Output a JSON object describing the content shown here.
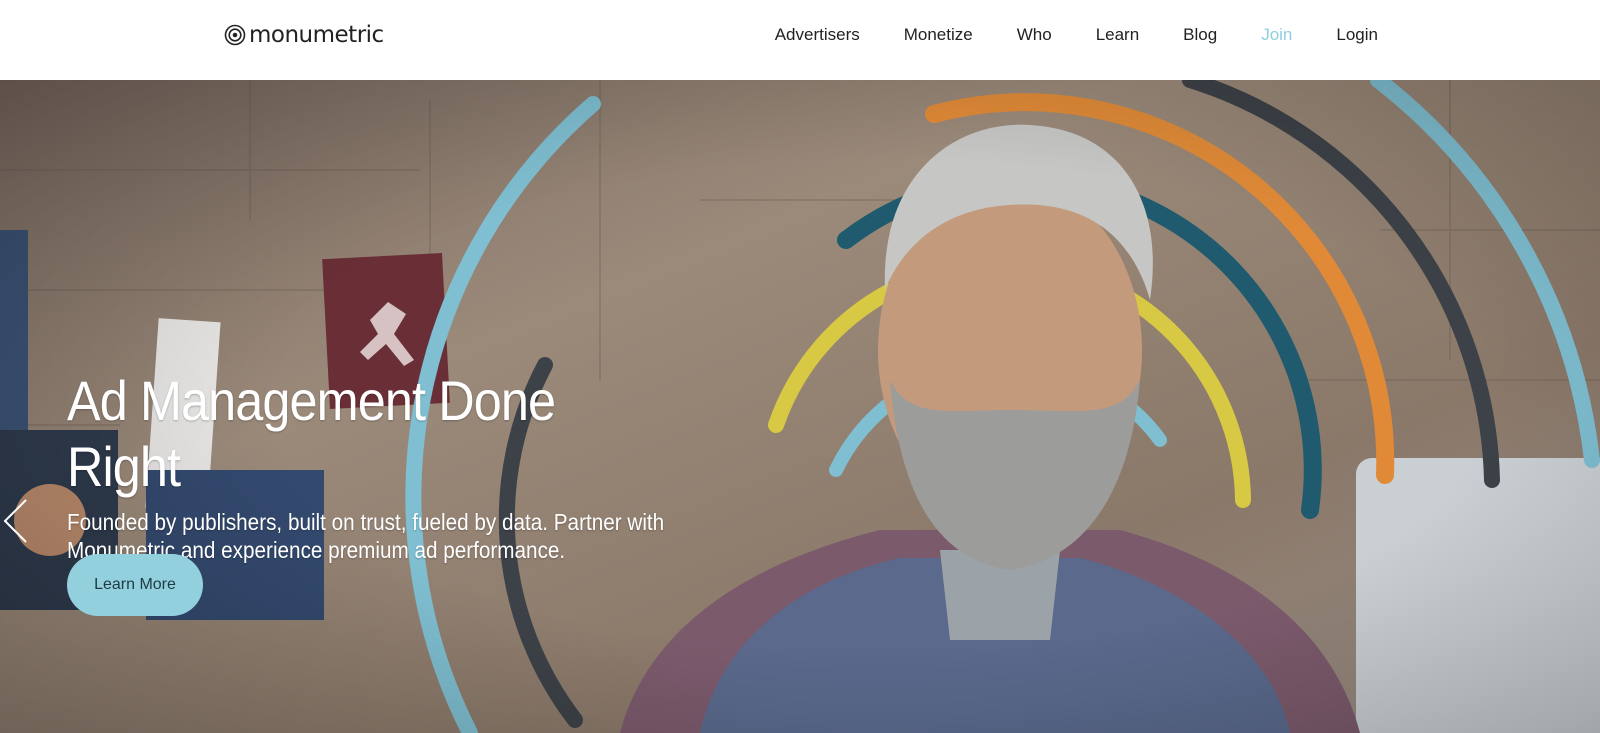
{
  "brand": {
    "name": "monumetric"
  },
  "nav": {
    "items": [
      {
        "label": "Advertisers"
      },
      {
        "label": "Monetize"
      },
      {
        "label": "Who"
      },
      {
        "label": "Learn"
      },
      {
        "label": "Blog"
      },
      {
        "label": "Join",
        "active": true
      },
      {
        "label": "Login"
      }
    ]
  },
  "hero": {
    "title": "Ad Management Done Right",
    "subtitle": "Founded by publishers, built on trust, fueled by data. Partner with Monumetric and experience premium ad performance.",
    "cta_label": "Learn More",
    "prev_icon": "chevron-left-icon"
  },
  "colors": {
    "accent_light_blue": "#8ecfe0",
    "teal": "#1f5a6e",
    "orange": "#e08a37",
    "yellow": "#d8c944",
    "charcoal": "#3d4248",
    "text_dark": "#222222"
  }
}
